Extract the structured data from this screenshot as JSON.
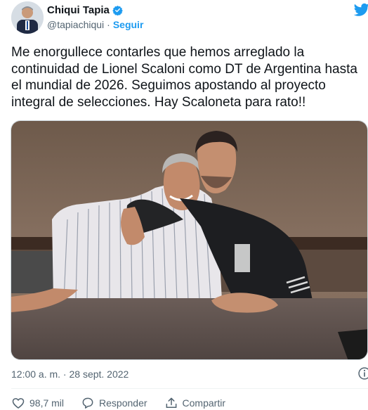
{
  "author": {
    "name": "Chiqui Tapia",
    "handle": "@tapiachiqui",
    "separator": "·",
    "follow_label": "Seguir"
  },
  "tweet": {
    "text_lines": [
      "Me enorgullece contarles que hemos arreglado la",
      "continuidad de Lionel Scaloni como DT de Argentina hasta",
      "el mundial de 2026. Seguimos apostando al proyecto",
      "integral de selecciones. Hay Scaloneta para rato!!"
    ],
    "timestamp": "12:00 a. m. · 28 sept. 2022"
  },
  "actions": {
    "like_count": "98,7 mil",
    "reply_label": "Responder",
    "share_label": "Compartir"
  },
  "icons": [
    "verified-icon",
    "twitter-bird-icon",
    "info-icon",
    "heart-icon",
    "reply-icon",
    "share-icon"
  ],
  "colors": {
    "accent": "#1d9bf0",
    "text": "#0f1419",
    "muted": "#536471"
  }
}
